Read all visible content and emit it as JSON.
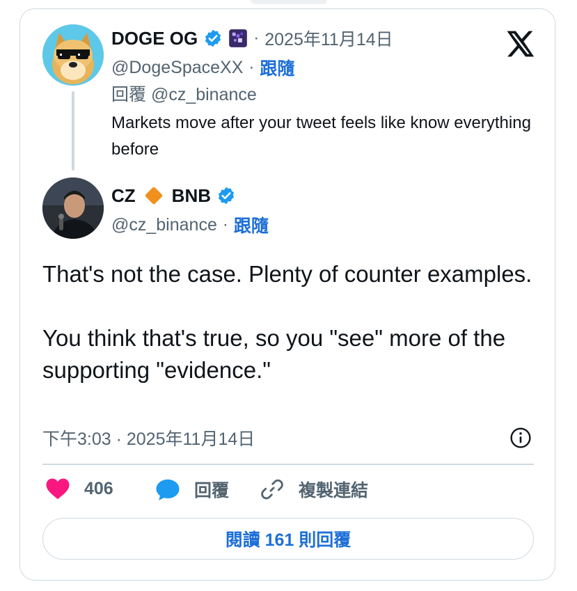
{
  "parent_tweet": {
    "display_name": "DOGE OG",
    "timestamp": "2025年11月14日",
    "handle": "@DogeSpaceXX",
    "follow_label": "跟隨",
    "reply_to": "回覆 @cz_binance",
    "text": "Markets move after your tweet feels like know everything before"
  },
  "main_tweet": {
    "display_name_part1": "CZ",
    "display_name_part2": "BNB",
    "handle": "@cz_binance",
    "follow_label": "跟隨",
    "text": "That's not the case. Plenty of counter examples.\n\nYou think that's true, so you \"see\" more of the supporting \"evidence.\"",
    "timestamp": "下午3:03 · 2025年11月14日"
  },
  "actions": {
    "like_count": "406",
    "reply_label": "回覆",
    "copy_link_label": "複製連結"
  },
  "read_replies_label": "閱讀 161 則回覆",
  "separator": "·",
  "icons": {
    "x_logo": "x-logo-icon",
    "verified": "verified-badge-icon",
    "affiliate": "affiliate-badge-icon",
    "diamond": "bnb-diamond-icon",
    "info": "info-icon",
    "heart": "heart-icon",
    "reply": "reply-bubble-icon",
    "link": "link-icon"
  },
  "colors": {
    "accent_blue": "#1d9bf0",
    "link_blue": "#1d6fd8",
    "heart": "#f91880",
    "diamond": "#f0901e",
    "muted": "#536471"
  }
}
